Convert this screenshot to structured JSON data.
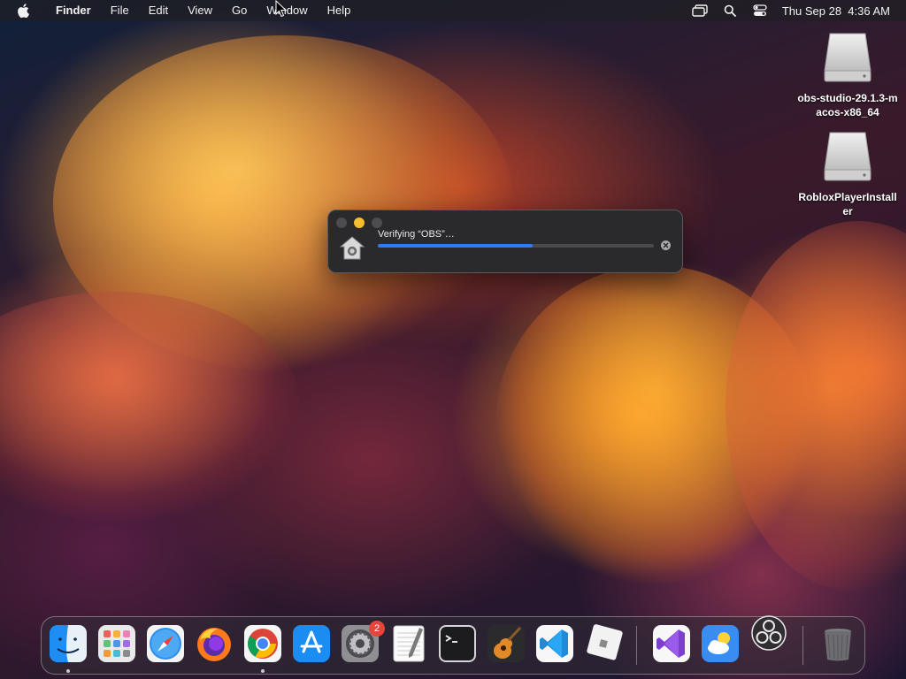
{
  "menubar": {
    "apple_icon": "apple-logo-icon",
    "items": [
      "Finder",
      "File",
      "Edit",
      "View",
      "Go",
      "Window",
      "Help"
    ],
    "status_icons": [
      "screen-mirroring-icon",
      "search-icon",
      "control-center-icon"
    ],
    "clock": "Thu Sep 28  4:36 AM"
  },
  "desktop_icons": [
    {
      "icon": "disk-image-icon",
      "label": "obs-studio-29.1.3-macos-x86_64"
    },
    {
      "icon": "disk-image-icon",
      "label": "RobloxPlayerInstaller"
    }
  ],
  "dialog": {
    "message": "Verifying “OBS”…",
    "progress_fraction": 0.56,
    "icon": "security-house-icon",
    "accent_color": "#2f7cf6"
  },
  "dock": {
    "apps": [
      {
        "name": "Finder",
        "icon": "finder-icon",
        "running": true
      },
      {
        "name": "Launchpad",
        "icon": "launchpad-icon",
        "running": false
      },
      {
        "name": "Safari",
        "icon": "safari-icon",
        "running": false
      },
      {
        "name": "Firefox",
        "icon": "firefox-icon",
        "running": false
      },
      {
        "name": "Google Chrome",
        "icon": "chrome-icon",
        "running": true
      },
      {
        "name": "App Store",
        "icon": "app-store-icon",
        "running": false
      },
      {
        "name": "System Settings",
        "icon": "system-settings-icon",
        "running": false,
        "badge": "2"
      },
      {
        "name": "TextEdit",
        "icon": "textedit-icon",
        "running": false
      },
      {
        "name": "Terminal",
        "icon": "terminal-icon",
        "running": false
      },
      {
        "name": "GarageBand",
        "icon": "garageband-icon",
        "running": false
      },
      {
        "name": "Visual Studio Code",
        "icon": "vscode-icon",
        "running": false
      },
      {
        "name": "Roblox",
        "icon": "roblox-icon",
        "running": false
      },
      {
        "name": "Visual Studio",
        "icon": "visual-studio-icon",
        "running": false
      },
      {
        "name": "Weather",
        "icon": "weather-icon",
        "running": false
      },
      {
        "name": "OBS",
        "icon": "obs-icon",
        "running": false
      },
      {
        "name": "Trash",
        "icon": "trash-icon",
        "running": false
      }
    ]
  }
}
